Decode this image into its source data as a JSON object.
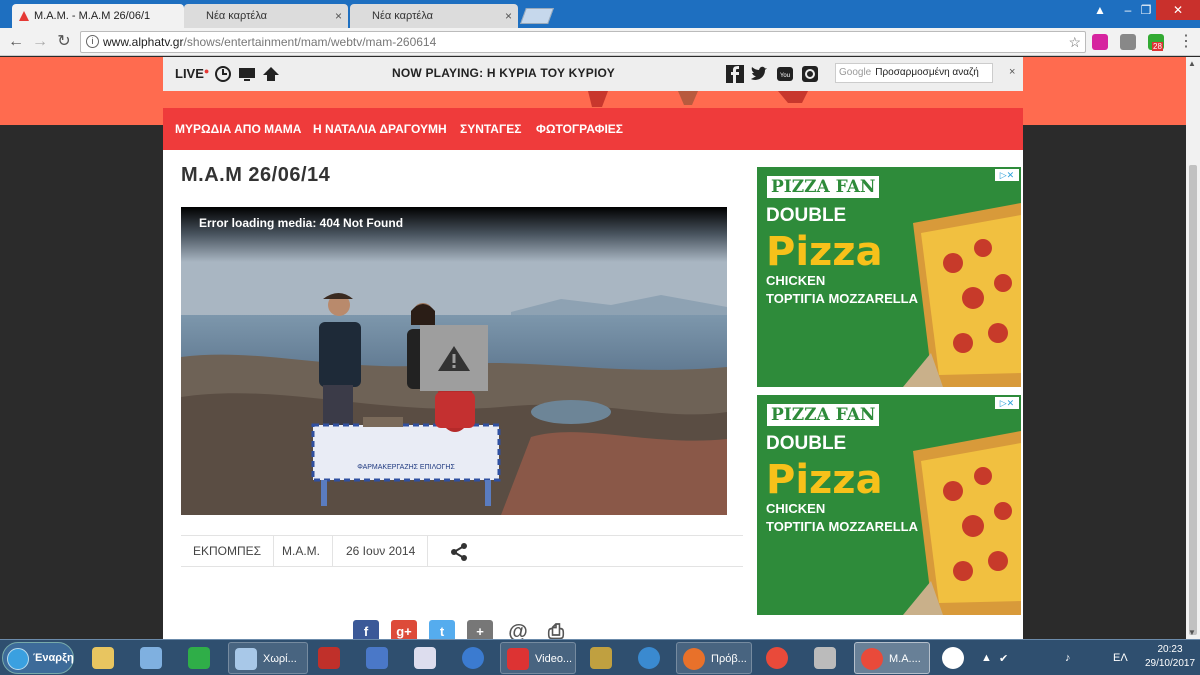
{
  "browser": {
    "tabs": [
      {
        "label": "Μ.Α.Μ. - Μ.Α.Μ 26/06/1",
        "active": true
      },
      {
        "label": "Νέα καρτέλα",
        "active": false
      },
      {
        "label": "Νέα καρτέλα",
        "active": false
      }
    ],
    "url_host": "www.alphatv.gr",
    "url_path": "/shows/entertainment/mam/webtv/mam-260614",
    "ext_badge": "28"
  },
  "site": {
    "live_label": "LIVE",
    "now_playing": "NOW PLAYING: Η ΚΥΡΙΑ ΤΟΥ ΚΥΡΙΟΥ",
    "search_brand": "Google",
    "search_placeholder": "Προσαρμοσμένη αναζή",
    "close": "×",
    "menu": [
      "ΜΥΡΩΔΙΑ ΑΠΟ ΜΑΜΑ",
      "Η ΝΑΤΑΛΙΑ ΔΡΑΓΟΥΜΗ",
      "ΣΥΝΤΑΓΕΣ",
      "ΦΩΤΟΓΡΑΦΙΕΣ"
    ]
  },
  "article": {
    "title": "Μ.Α.Μ 26/06/14",
    "video_error": "Error loading media: 404 Not Found",
    "table_banner": "ΦΑΡΜΑΚΕΡΓΑΖΗΣ ΕΠΙΛΟΓΗΣ",
    "meta": [
      "ΕΚΠΟΜΠΕΣ",
      "Μ.Α.Μ.",
      "26 Ιουν 2014"
    ],
    "social": [
      {
        "name": "facebook",
        "glyph": "f",
        "color": "#3b5998"
      },
      {
        "name": "googleplus",
        "glyph": "g+",
        "color": "#dd4b39"
      },
      {
        "name": "twitter",
        "glyph": "t",
        "color": "#55acee"
      },
      {
        "name": "add",
        "glyph": "+",
        "color": "#777777"
      },
      {
        "name": "email",
        "glyph": "@",
        "color": "#555555"
      },
      {
        "name": "print",
        "glyph": "⎙",
        "color": "#555555"
      }
    ]
  },
  "ads": [
    {
      "brand": "PIZZA FAN",
      "headline": "DOUBLE",
      "product": "Pizza",
      "line1": "CHICKEN",
      "line2": "ΤΟΡΤΙΓΙΑ MOZZARELLA",
      "adchoices": "▷✕"
    },
    {
      "brand": "PIZZA FAN",
      "headline": "DOUBLE",
      "product": "Pizza",
      "line1": "CHICKEN",
      "line2": "ΤΟΡΤΙΓΙΑ MOZZARELLA",
      "adchoices": "▷✕"
    }
  ],
  "taskbar": {
    "start": "Έναρξη",
    "items": [
      {
        "label": "Χωρί...",
        "icon": "notepad-icon"
      },
      {
        "label": "Video...",
        "icon": "video-app-icon"
      },
      {
        "label": "Πρόβ...",
        "icon": "firefox-icon"
      },
      {
        "label": "Μ.Α....",
        "icon": "chrome-icon"
      }
    ],
    "lang": "ΕΛ",
    "time": "20:23",
    "date": "29/10/2017"
  },
  "colors": {
    "accent_red": "#ef3b3b",
    "hero_orange": "#ff6b4f",
    "ad_green": "#2e8b3a",
    "ad_yellow": "#f7c11a"
  }
}
